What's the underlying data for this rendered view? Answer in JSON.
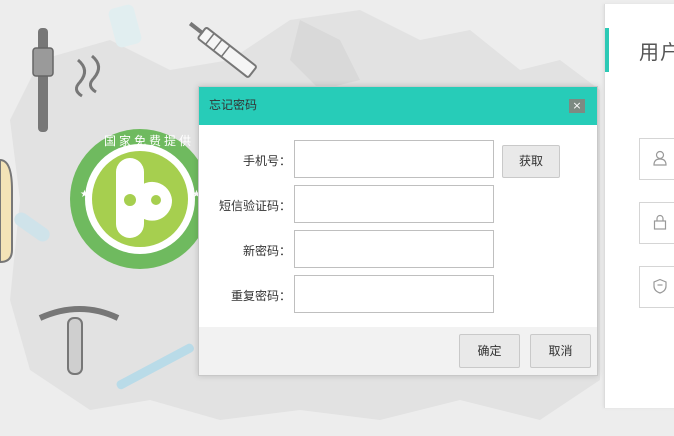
{
  "dialog": {
    "title": "忘记密码",
    "close_glyph": "×",
    "fields": [
      {
        "label": "手机号：",
        "value": "",
        "placeholder": ""
      },
      {
        "label": "短信验证码：",
        "value": "",
        "placeholder": ""
      },
      {
        "label": "新密码：",
        "value": "",
        "placeholder": ""
      },
      {
        "label": "重复密码：",
        "value": "",
        "placeholder": ""
      }
    ],
    "get_code_label": "获取",
    "confirm_label": "确定",
    "cancel_label": "取消"
  },
  "right_panel": {
    "title": "用户",
    "field_icons": [
      "user-icon",
      "lock-icon",
      "shield-icon"
    ]
  },
  "background": {
    "badge_text": "国家免费提供",
    "badge_glyph": "★"
  },
  "colors": {
    "accent": "#27ccb8",
    "badge_green": "#6fba5f",
    "badge_inner": "#a6cf4f"
  }
}
